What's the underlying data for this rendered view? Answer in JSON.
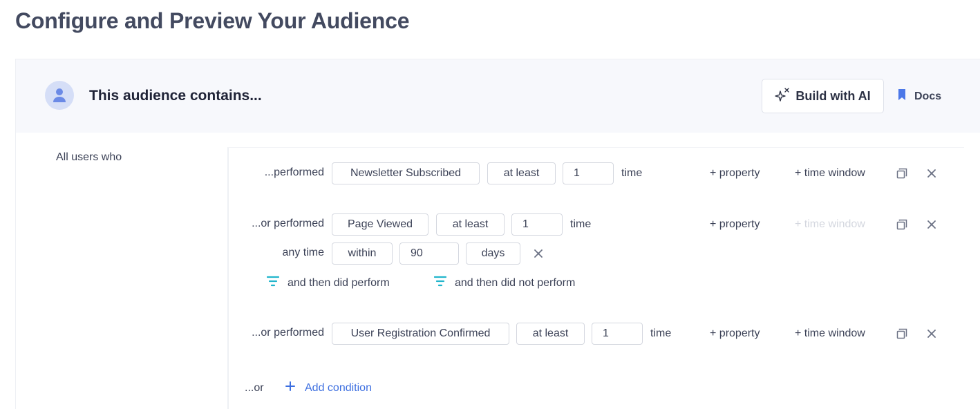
{
  "page": {
    "title": "Configure and Preview Your Audience"
  },
  "header": {
    "title": "This audience contains...",
    "build_ai_label": "Build with AI",
    "docs_label": "Docs",
    "avatar_icon": "user-icon",
    "ai_icon": "sparkle-icon",
    "docs_icon": "bookmark-icon"
  },
  "lhs_label": "All users who",
  "conditions": [
    {
      "prefix": "...performed",
      "event": "Newsletter Subscribed",
      "operator": "at least",
      "count": "1",
      "unit": "time",
      "property_label": "+ property",
      "time_window_label": "+ time window",
      "time_window_enabled": true
    },
    {
      "prefix": "...or performed",
      "event": "Page Viewed",
      "operator": "at least",
      "count": "1",
      "unit": "time",
      "property_label": "+ property",
      "time_window_label": "+ time window",
      "time_window_enabled": false,
      "time_window": {
        "label": "any time",
        "mode": "within",
        "value": "90",
        "unit": "days"
      },
      "then_did_perform": "and then did perform",
      "then_did_not_perform": "and then did not perform"
    },
    {
      "prefix": "...or performed",
      "event": "User Registration Confirmed",
      "operator": "at least",
      "count": "1",
      "unit": "time",
      "property_label": "+ property",
      "time_window_label": "+ time window",
      "time_window_enabled": true
    }
  ],
  "footer": {
    "or_label": "...or",
    "add_condition_label": "Add condition"
  },
  "colors": {
    "accent": "#3d6fe0",
    "funnel": "#22b5cc",
    "avatar_bg": "#d5def7",
    "avatar_fg": "#6b8ae6",
    "docs_icon": "#4c78e8"
  }
}
